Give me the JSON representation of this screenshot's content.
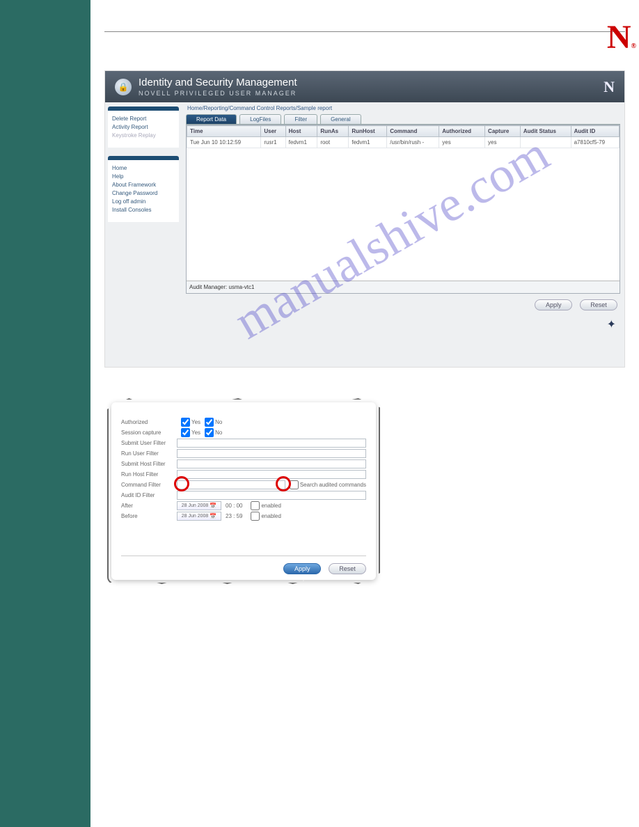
{
  "watermark": "manualshive.com",
  "header": {
    "title": "Identity and Security Management",
    "subtitle": "NOVELL PRIVILEGED USER MANAGER"
  },
  "breadcrumb": "Home/Reporting/Command Control Reports/Sample report",
  "sidebar": {
    "group1": [
      {
        "label": "Delete Report",
        "dim": false
      },
      {
        "label": "Activity Report",
        "dim": false
      },
      {
        "label": "Keystroke Replay",
        "dim": true
      }
    ],
    "group2": [
      {
        "label": "Home",
        "dim": false
      },
      {
        "label": "Help",
        "dim": false
      },
      {
        "label": "About Framework",
        "dim": false
      },
      {
        "label": "Change Password",
        "dim": false
      },
      {
        "label": "Log off admin",
        "dim": false
      },
      {
        "label": "Install Consoles",
        "dim": false
      }
    ]
  },
  "tabs": [
    "Report Data",
    "LogFiles",
    "Filter",
    "General"
  ],
  "active_tab": 0,
  "grid": {
    "columns": [
      "Time",
      "User",
      "Host",
      "RunAs",
      "RunHost",
      "Command",
      "Authorized",
      "Capture",
      "Audit Status",
      "Audit ID"
    ],
    "rows": [
      [
        "Tue Jun 10 10:12:59",
        "rusr1",
        "fedvm1",
        "root",
        "fedvm1",
        "/usr/bin/rush -",
        "yes",
        "yes",
        "",
        "a7810cf5-79"
      ]
    ]
  },
  "audit_manager_label": "Audit Manager:",
  "audit_manager_value": "usma-vtc1",
  "buttons": {
    "apply": "Apply",
    "reset": "Reset"
  },
  "filter": {
    "authorized": {
      "label": "Authorized",
      "yes": "Yes",
      "no": "No",
      "yes_checked": true,
      "no_checked": true
    },
    "session_capture": {
      "label": "Session capture",
      "yes": "Yes",
      "no": "No",
      "yes_checked": true,
      "no_checked": true
    },
    "rows": [
      {
        "label": "Submit User Filter",
        "key": "submit_user"
      },
      {
        "label": "Run User Filter",
        "key": "run_user"
      },
      {
        "label": "Submit Host Filter",
        "key": "submit_host"
      },
      {
        "label": "Run Host Filter",
        "key": "run_host"
      },
      {
        "label": "Command Filter",
        "key": "command",
        "extra_checkbox": "Search audited commands"
      },
      {
        "label": "Audit ID Filter",
        "key": "audit_id"
      }
    ],
    "after": {
      "label": "After",
      "date": "28 Jun 2008",
      "time": "00 : 00",
      "enabled_label": "enabled"
    },
    "before": {
      "label": "Before",
      "date": "28 Jun 2008",
      "time": "23 : 59",
      "enabled_label": "enabled"
    }
  }
}
